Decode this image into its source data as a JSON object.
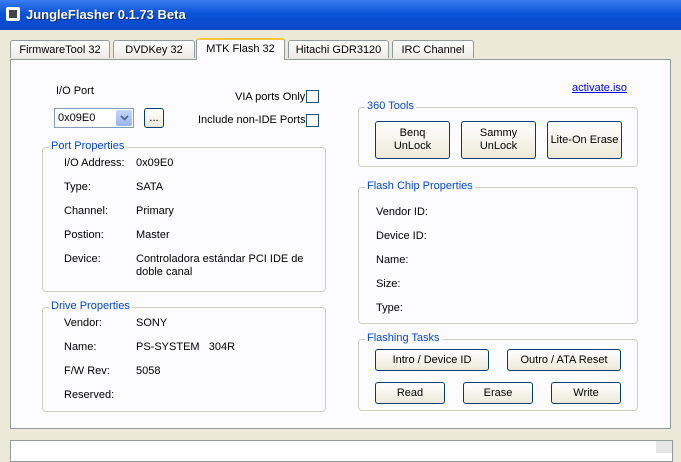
{
  "window": {
    "title": "JungleFlasher 0.1.73 Beta"
  },
  "tabs": [
    {
      "label": "FirmwareTool 32"
    },
    {
      "label": "DVDKey 32"
    },
    {
      "label": "MTK Flash 32",
      "active": true
    },
    {
      "label": "Hitachi GDR3120"
    },
    {
      "label": "IRC Channel"
    }
  ],
  "io": {
    "label": "I/O Port",
    "value": "0x09E0",
    "browse": "...",
    "via_only": "VIA ports Only",
    "include_non_ide": "Include non-IDE Ports"
  },
  "activate_link": "activate.iso",
  "port_properties": {
    "title": "Port Properties",
    "rows": [
      {
        "label": "I/O Address:",
        "value": "0x09E0"
      },
      {
        "label": "Type:",
        "value": "SATA"
      },
      {
        "label": "Channel:",
        "value": "Primary"
      },
      {
        "label": "Postion:",
        "value": "Master"
      },
      {
        "label": "Device:",
        "value": "Controladora estándar PCI IDE de",
        "value2": "doble canal"
      }
    ]
  },
  "drive_properties": {
    "title": "Drive Properties",
    "rows": [
      {
        "label": "Vendor:",
        "value": "SONY"
      },
      {
        "label": "Name:",
        "value": "PS-SYSTEM   304R"
      },
      {
        "label": "F/W Rev:",
        "value": "5058"
      },
      {
        "label": "Reserved:",
        "value": ""
      }
    ]
  },
  "tools360": {
    "title": "360 Tools",
    "benq_line1": "Benq",
    "benq_line2": "UnLock",
    "sammy_line1": "Sammy",
    "sammy_line2": "UnLock",
    "liteon": "Lite-On Erase"
  },
  "flash_chip": {
    "title": "Flash Chip Properties",
    "rows": [
      {
        "label": "Vendor ID:"
      },
      {
        "label": "Device ID:"
      },
      {
        "label": "Name:"
      },
      {
        "label": "Size:"
      },
      {
        "label": "Type:"
      }
    ]
  },
  "flashing": {
    "title": "Flashing Tasks",
    "intro": "Intro / Device ID",
    "outro": "Outro / ATA Reset",
    "read": "Read",
    "erase": "Erase",
    "write": "Write"
  }
}
